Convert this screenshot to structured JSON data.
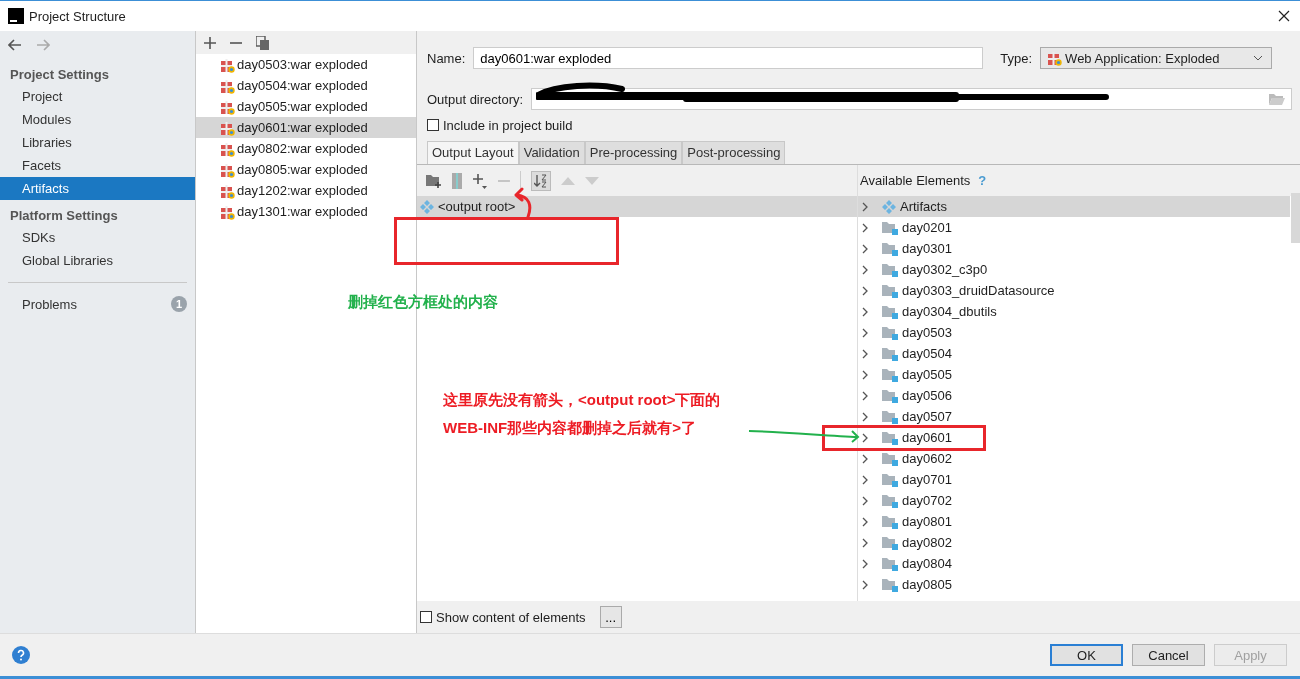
{
  "window": {
    "title": "Project Structure"
  },
  "sidebar": {
    "sections": [
      {
        "header": "Project Settings",
        "items": [
          {
            "label": "Project",
            "selected": false
          },
          {
            "label": "Modules",
            "selected": false
          },
          {
            "label": "Libraries",
            "selected": false
          },
          {
            "label": "Facets",
            "selected": false
          },
          {
            "label": "Artifacts",
            "selected": true
          }
        ]
      },
      {
        "header": "Platform Settings",
        "items": [
          {
            "label": "SDKs",
            "selected": false
          },
          {
            "label": "Global Libraries",
            "selected": false
          }
        ]
      }
    ],
    "problems": {
      "label": "Problems",
      "count": "1"
    }
  },
  "artifacts": [
    {
      "label": "day0503:war exploded",
      "selected": false
    },
    {
      "label": "day0504:war exploded",
      "selected": false
    },
    {
      "label": "day0505:war exploded",
      "selected": false
    },
    {
      "label": "day0601:war exploded",
      "selected": true
    },
    {
      "label": "day0802:war exploded",
      "selected": false
    },
    {
      "label": "day0805:war exploded",
      "selected": false
    },
    {
      "label": "day1202:war exploded",
      "selected": false
    },
    {
      "label": "day1301:war exploded",
      "selected": false
    }
  ],
  "form": {
    "name_label": "Name:",
    "name_value": "day0601:war exploded",
    "type_label": "Type:",
    "type_value": "Web Application: Exploded",
    "output_label": "Output directory:",
    "include": {
      "label": "Include in project build",
      "checked": false
    }
  },
  "tabs": [
    {
      "label": "Output Layout",
      "selected": true
    },
    {
      "label": "Validation",
      "selected": false
    },
    {
      "label": "Pre-processing",
      "selected": false
    },
    {
      "label": "Post-processing",
      "selected": false
    }
  ],
  "layout_tree": [
    {
      "label": "<output root>",
      "selected": true
    }
  ],
  "available": {
    "title": "Available Elements",
    "help": "?",
    "items": [
      {
        "label": "Artifacts",
        "kind": "artifacts",
        "selected": true
      },
      {
        "label": "day0201",
        "kind": "module",
        "selected": false
      },
      {
        "label": "day0301",
        "kind": "module",
        "selected": false
      },
      {
        "label": "day0302_c3p0",
        "kind": "module",
        "selected": false
      },
      {
        "label": "day0303_druidDatasource",
        "kind": "module",
        "selected": false
      },
      {
        "label": "day0304_dbutils",
        "kind": "module",
        "selected": false
      },
      {
        "label": "day0503",
        "kind": "module",
        "selected": false
      },
      {
        "label": "day0504",
        "kind": "module",
        "selected": false
      },
      {
        "label": "day0505",
        "kind": "module",
        "selected": false
      },
      {
        "label": "day0506",
        "kind": "module",
        "selected": false
      },
      {
        "label": "day0507",
        "kind": "module",
        "selected": false
      },
      {
        "label": "day0601",
        "kind": "module",
        "selected": false
      },
      {
        "label": "day0602",
        "kind": "module",
        "selected": false
      },
      {
        "label": "day0701",
        "kind": "module",
        "selected": false
      },
      {
        "label": "day0702",
        "kind": "module",
        "selected": false
      },
      {
        "label": "day0801",
        "kind": "module",
        "selected": false
      },
      {
        "label": "day0802",
        "kind": "module",
        "selected": false
      },
      {
        "label": "day0804",
        "kind": "module",
        "selected": false
      },
      {
        "label": "day0805",
        "kind": "module",
        "selected": false
      }
    ]
  },
  "show_content": {
    "label": "Show content of elements",
    "checked": false
  },
  "more_button": "...",
  "buttons": [
    {
      "label": "OK",
      "kind": "default",
      "disabled": false
    },
    {
      "label": "Cancel",
      "kind": "normal",
      "disabled": false
    },
    {
      "label": "Apply",
      "kind": "normal",
      "disabled": true
    }
  ],
  "annotations": [
    {
      "lines": [
        "删掉红色方框处的内容"
      ],
      "color": "#22b14c"
    },
    {
      "lines": [
        "这里原先没有箭头，<output root>下面的",
        "WEB-INF那些内容都删掉之后就有>了"
      ],
      "color": "#ed1c24"
    }
  ]
}
